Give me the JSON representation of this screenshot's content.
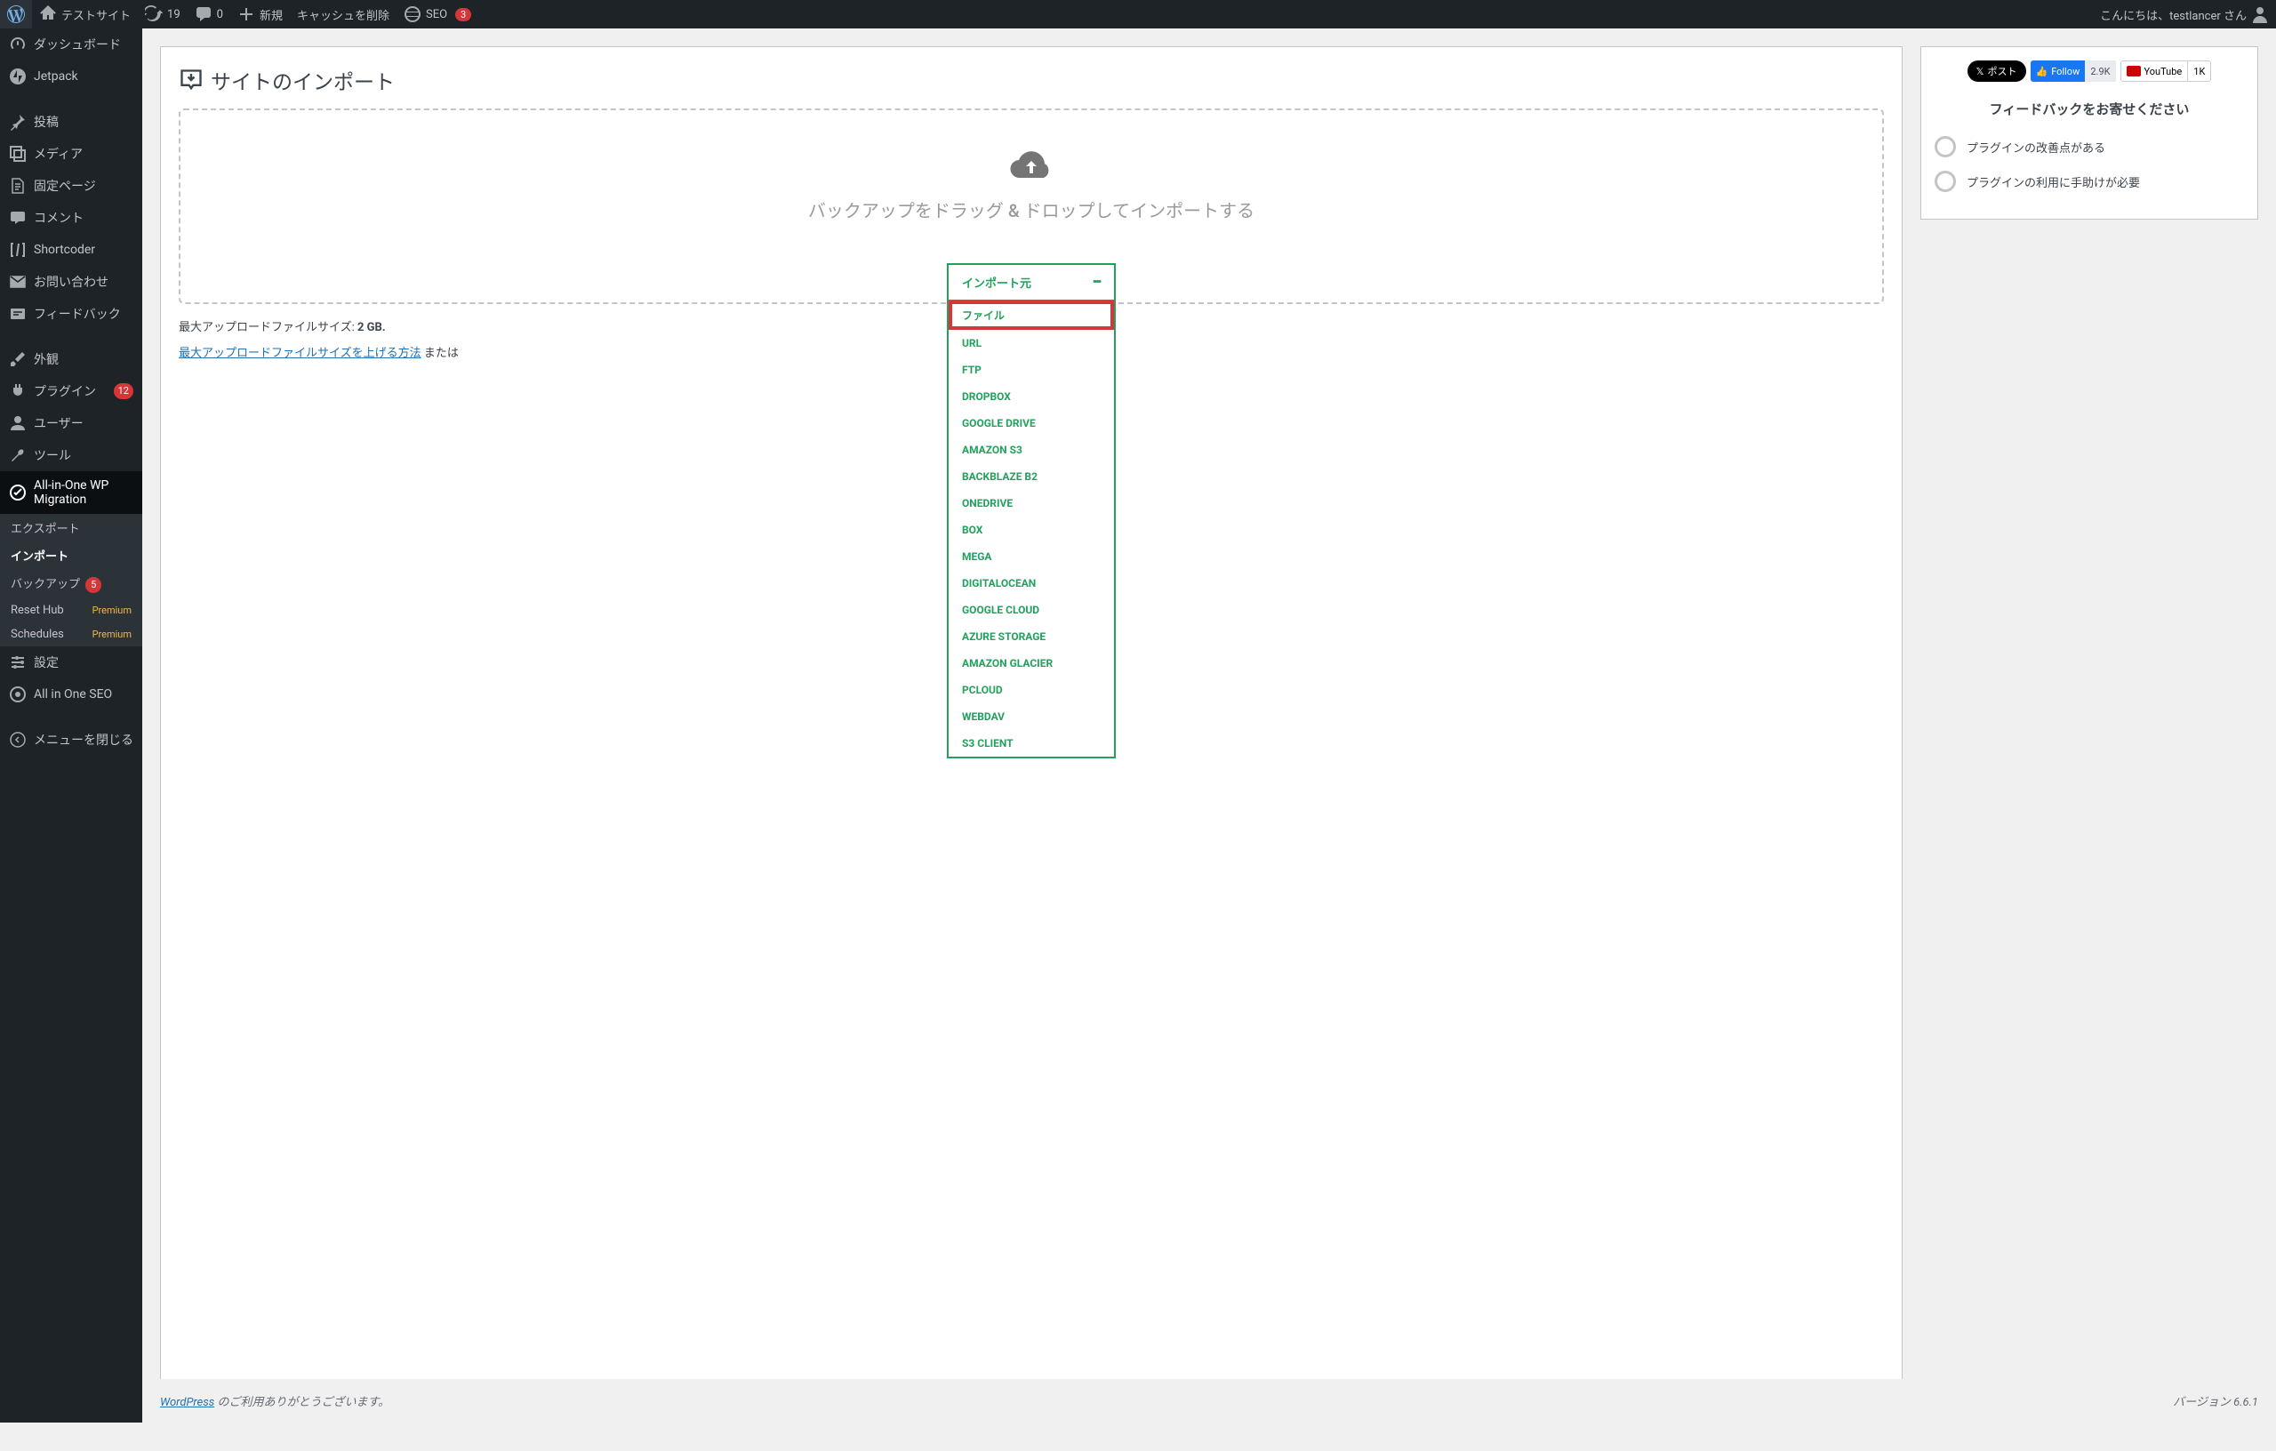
{
  "adminbar": {
    "site_name": "テストサイト",
    "updates": "19",
    "comments": "0",
    "new": "新規",
    "cache": "キャッシュを削除",
    "seo": "SEO",
    "seo_count": "3",
    "greeting": "こんにちは、testlancer さん"
  },
  "sidebar": {
    "dashboard": "ダッシュボード",
    "jetpack": "Jetpack",
    "posts": "投稿",
    "media": "メディア",
    "pages": "固定ページ",
    "comments": "コメント",
    "shortcoder": "Shortcoder",
    "contact": "お問い合わせ",
    "feedback": "フィードバック",
    "appearance": "外観",
    "plugins": "プラグイン",
    "plugins_count": "12",
    "users": "ユーザー",
    "tools": "ツール",
    "migration": "All-in-One WP Migration",
    "export": "エクスポート",
    "import": "インポート",
    "backup": "バックアップ",
    "backup_count": "5",
    "resethub": "Reset Hub",
    "schedules": "Schedules",
    "premium": "Premium",
    "settings": "設定",
    "aioseo": "All in One SEO",
    "collapse": "メニューを閉じる"
  },
  "main": {
    "page_title": "サイトのインポート",
    "dropzone_text": "バックアップをドラッグ & ドロップしてインポートする",
    "upload_size_label": "最大アップロードファイルサイズ: ",
    "upload_size_value": "2 GB.",
    "upgrade_link": "最大アップロードファイルサイズを上げる方法",
    "or_text": " または"
  },
  "dropdown": {
    "header": "インポート元",
    "options": [
      "ファイル",
      "URL",
      "FTP",
      "DROPBOX",
      "GOOGLE DRIVE",
      "AMAZON S3",
      "BACKBLAZE B2",
      "ONEDRIVE",
      "BOX",
      "MEGA",
      "DIGITALOCEAN",
      "GOOGLE CLOUD",
      "AZURE STORAGE",
      "AMAZON GLACIER",
      "PCLOUD",
      "WEBDAV",
      "S3 CLIENT"
    ]
  },
  "sidebox": {
    "x_label": "ポスト",
    "fb_label": "Follow",
    "fb_count": "2.9K",
    "yt_label": "YouTube",
    "yt_count": "1K",
    "feedback_title": "フィードバックをお寄せください",
    "opt1": "プラグインの改善点がある",
    "opt2": "プラグインの利用に手助けが必要"
  },
  "footer": {
    "wp": "WordPress",
    "thanks": " のご利用ありがとうございます。",
    "version": "バージョン 6.6.1"
  }
}
